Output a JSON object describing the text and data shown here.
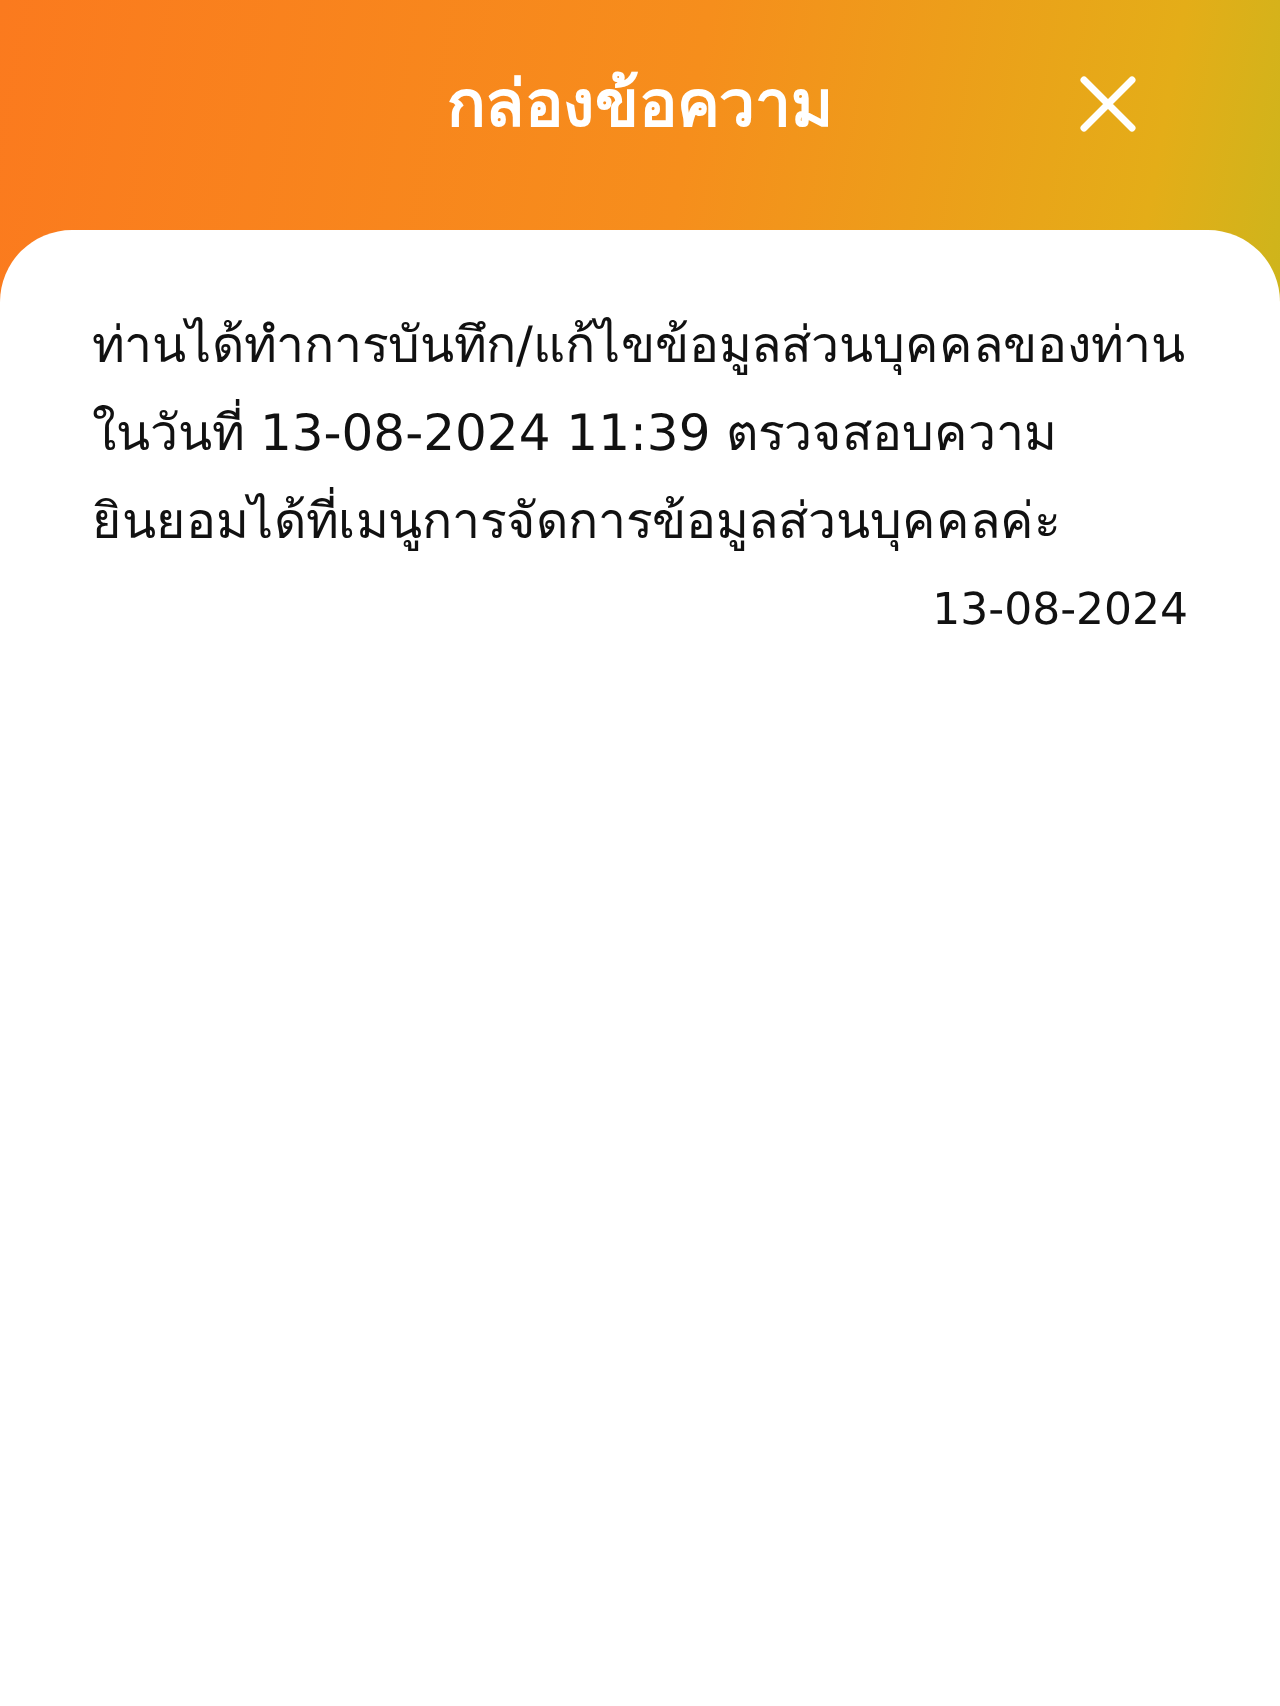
{
  "header": {
    "title": "กล่องข้อความ"
  },
  "messages": [
    {
      "text": "ท่านได้ทำการบันทึก/แก้ไขข้อมูลส่วนบุคคลของท่านในวันที่ 13-08-2024 11:39 ตรวจสอบความยินยอมได้ที่เมนูการจัดการข้อมูลส่วนบุคคลค่ะ",
      "date": "13-08-2024"
    }
  ]
}
